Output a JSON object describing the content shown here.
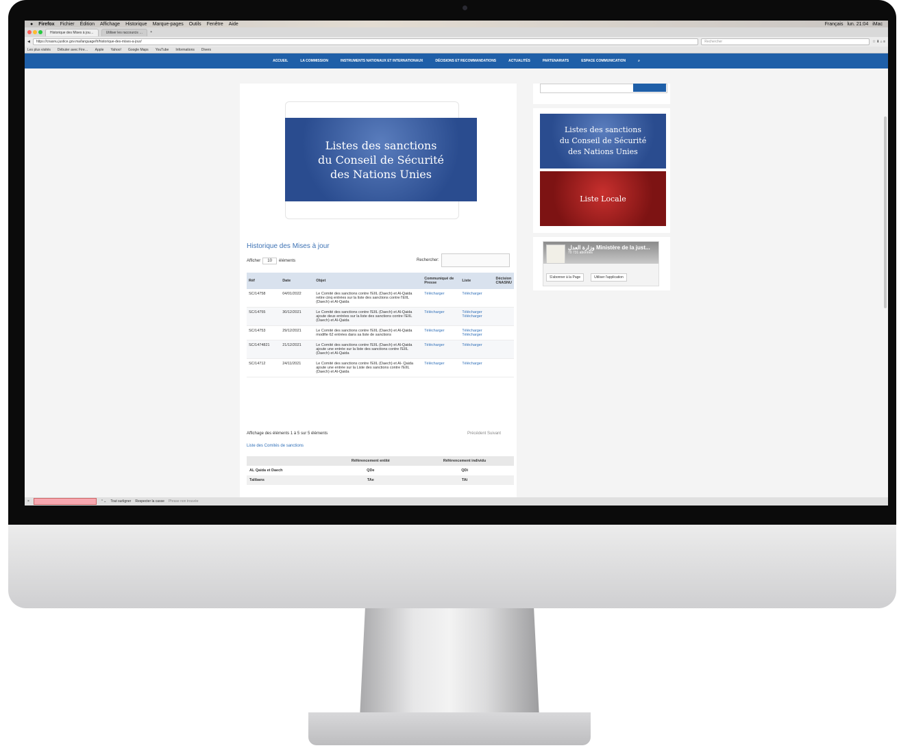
{
  "menubar": {
    "app": "Firefox",
    "items": [
      "Fichier",
      "Édition",
      "Affichage",
      "Historique",
      "Marque-pages",
      "Outils",
      "Fenêtre",
      "Aide"
    ],
    "lang": "Français",
    "clock": "lun. 21:04",
    "user": "iMac"
  },
  "tabs": [
    {
      "label": "Historique des Mises à jou…"
    },
    {
      "label": "Utiliser les raccourcis …"
    }
  ],
  "url": "https://cnasnu.justice.gov.ma/language/fr/historique-des-mises-a-jour/",
  "search_placeholder": "Rechercher",
  "bookmarks": [
    "Les plus visités",
    "Débuter avec Fire…",
    "Apple",
    "Yahoo!",
    "Google Maps",
    "YouTube",
    "Informations",
    "Divers"
  ],
  "nav": [
    "ACCUEIL",
    "LA COMMISSION",
    "INSTRUMENTS NATIONAUX ET INTERNATIONAUX",
    "DÉCISIONS ET RECOMMANDATIONS",
    "ACTUALITÉS",
    "PARTENARIATS",
    "ESPACE COMMUNICATION"
  ],
  "banner": {
    "l1": "Listes des sanctions",
    "l2": "du Conseil de Sécurité",
    "l3": "des Nations Unies"
  },
  "section_title": "Historique des Mises à jour",
  "show": {
    "label": "Afficher",
    "value": "10",
    "suffix": "éléments"
  },
  "filter_label": "Rechercher:",
  "table": {
    "headers": [
      "Réf",
      "Date",
      "Objet",
      "Communiqué de Presse",
      "Liste",
      "Décision CNASNU"
    ],
    "rows": [
      {
        "ref": "SC/14758",
        "date": "04/01/2022",
        "objet": "Le Comité des sanctions contre l'EIIL (Daech) et Al-Qaida retire cinq entrées sur la liste des sanctions contre l'EIIL (Daech) et Al-Qaida",
        "press": "Télécharger",
        "list": "Télécharger"
      },
      {
        "ref": "SC/14755",
        "date": "30/12/2021",
        "objet": "Le Comité des sanctions contre l'EIIL (Daech) et Al-Qaida ajoute deux entrées sur la liste des sanctions contre l'EIIL (Daech) et Al-Qaida",
        "press": "Télécharger",
        "list": "Télécharger Télécharger"
      },
      {
        "ref": "SC/14753",
        "date": "29/12/2021",
        "objet": "Le Comité des sanctions contre l'EIIL (Daech) et Al-Qaida modifie 62 entrées dans sa liste de sanctions",
        "press": "Télécharger",
        "list": "Télécharger Télécharger"
      },
      {
        "ref": "SC/1474821",
        "date": "21/12/2021",
        "objet": "Le Comité des sanctions contre l'EIIL (Daech) et Al-Qaida ajoute une entrée sur la liste des sanctions contre l'EIIL (Daech) et Al-Qaida",
        "press": "Télécharger",
        "list": "Télécharger"
      },
      {
        "ref": "SC/14712",
        "date": "24/11/2021",
        "objet": "Le Comité des sanctions contre l'EIIL (Daech) et Al- Qaida ajoute une entrée sur la Liste des sanctions contre l'EIIL (Daech) et Al-Qaida",
        "press": "Télécharger",
        "list": "Télécharger"
      }
    ]
  },
  "info": "Affichage des éléments 1 à 5 sur 5 éléments",
  "pager": {
    "prev": "Précédent",
    "next": "Suivant"
  },
  "committee_link": "Liste des Comités de sanctions",
  "ref_table": {
    "headers": [
      "",
      "Référencement entité",
      "Référencement individu"
    ],
    "rows": [
      [
        "AL Qaida et Daech",
        "QDe",
        "QDi"
      ],
      [
        "Talibans",
        "TAe",
        "TAi"
      ]
    ]
  },
  "sidebar": {
    "b1": {
      "l1": "Listes des sanctions",
      "l2": "du Conseil de Sécurité",
      "l3": "des Nations Unies"
    },
    "b2": "Liste Locale",
    "fb_title": "وزارة العدل Ministère de la just...",
    "fb_sub": "70 731 abonnés",
    "fb_follow": "S'abonner à la Page",
    "fb_app": "Utiliser l'application"
  },
  "findbar": {
    "all": "Tout surligner",
    "case": "Respecter la casse",
    "status": "Phrase non trouvée"
  }
}
